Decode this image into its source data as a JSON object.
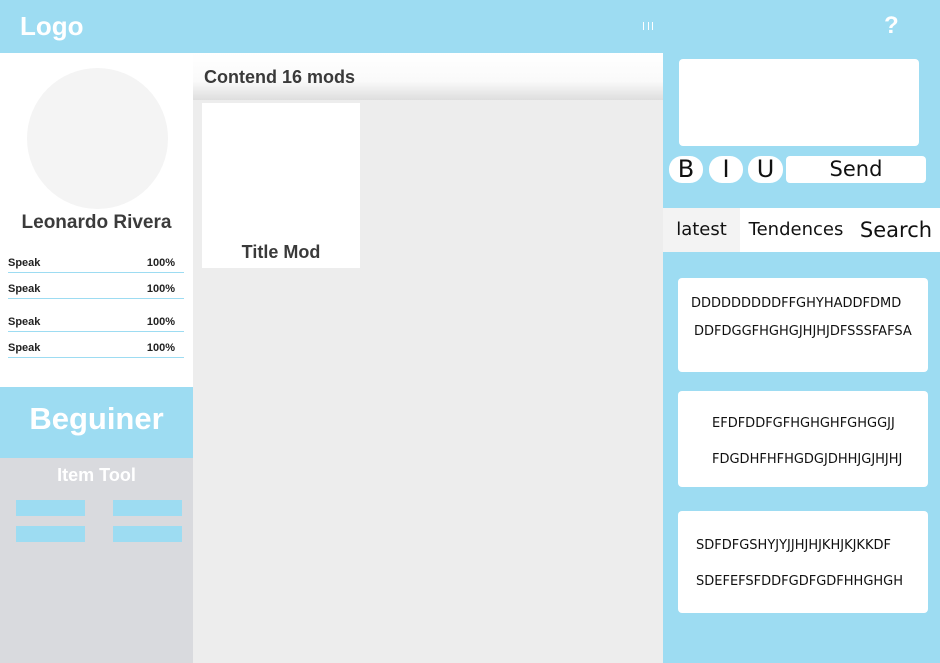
{
  "header": {
    "logo": "Logo",
    "menu_icon": "three-bars-icon"
  },
  "profile": {
    "name": "Leonardo Rivera",
    "stats": [
      {
        "label": "Speak",
        "value": "100%"
      },
      {
        "label": "Speak",
        "value": "100%"
      },
      {
        "label": "Speak",
        "value": "100%"
      },
      {
        "label": "Speak",
        "value": "100%"
      }
    ],
    "level": "Beguiner",
    "tool_title": "Item Tool"
  },
  "content": {
    "title": "Contend 16 mods",
    "mods": [
      {
        "title": "Title Mod"
      }
    ]
  },
  "chat": {
    "help_icon": "?",
    "format_buttons": {
      "bold": "B",
      "italic": "I",
      "underline": "U"
    },
    "send_label": "Send",
    "tabs": {
      "latest": "latest",
      "trends": "Tendences",
      "search": "Search"
    },
    "posts": [
      {
        "line1": "DDDDDDDDDFFGHYHADDFDMD",
        "line2": "DDFDGGFHGHGJHJHJDFSSSFAFSA"
      },
      {
        "line1": "EFDFDDFGFHGHGHFGHGGJJ",
        "line2": "FDGDHFHFHGDGJDHHJGJHJHJ"
      },
      {
        "line1": "SDFDFGSHYJYJJHJHJKHJKJKKDF",
        "line2": "SDEFEFSFDDFGDFGDFHHGHGH"
      }
    ]
  },
  "colors": {
    "accent": "#9ddcf2",
    "panel_gray": "#d9dade",
    "content_bg": "#ededed"
  }
}
